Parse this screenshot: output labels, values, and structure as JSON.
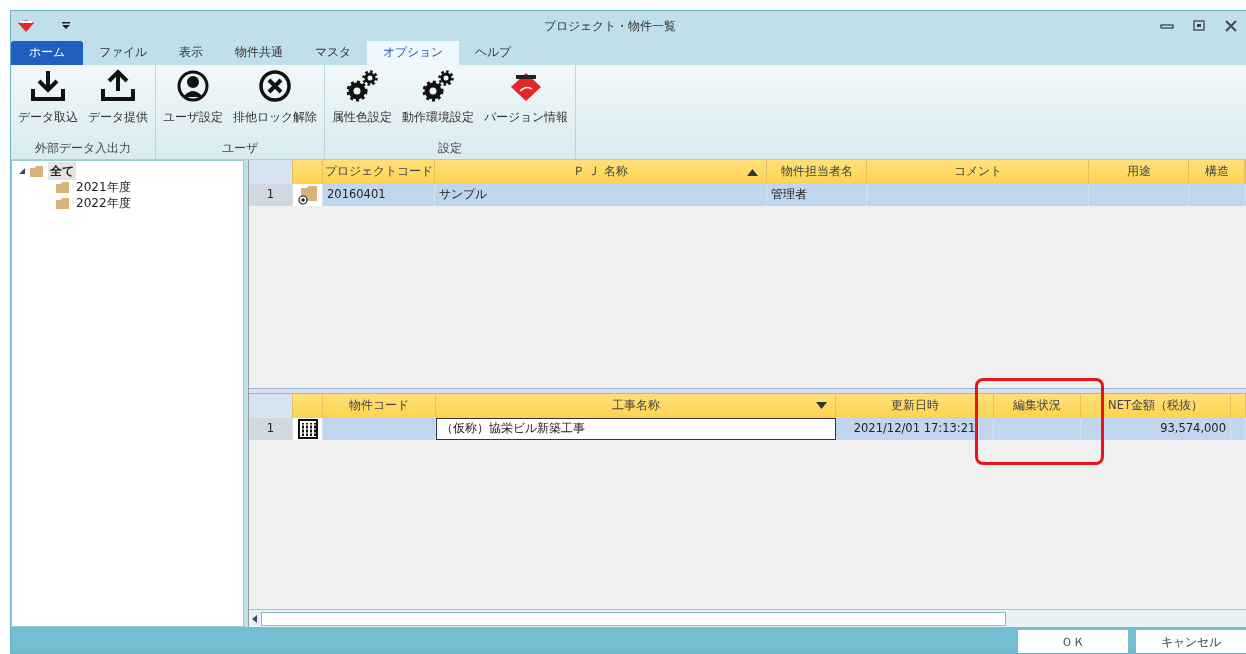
{
  "window": {
    "title": "プロジェクト・物件一覧"
  },
  "tabs": [
    {
      "label": "ホーム",
      "kind": "home",
      "selected": false
    },
    {
      "label": "ファイル",
      "kind": "tab",
      "selected": false
    },
    {
      "label": "表示",
      "kind": "tab",
      "selected": false
    },
    {
      "label": "物件共通",
      "kind": "tab",
      "selected": false
    },
    {
      "label": "マスタ",
      "kind": "tab",
      "selected": false
    },
    {
      "label": "オプション",
      "kind": "tab",
      "selected": true
    },
    {
      "label": "ヘルプ",
      "kind": "tab",
      "selected": false
    }
  ],
  "ribbon_groups": [
    {
      "label": "外部データ入出力",
      "buttons": [
        {
          "label": "データ取込"
        },
        {
          "label": "データ提供"
        }
      ]
    },
    {
      "label": "ユーザ",
      "buttons": [
        {
          "label": "ユーザ設定"
        },
        {
          "label": "排他ロック解除"
        }
      ]
    },
    {
      "label": "設定",
      "buttons": [
        {
          "label": "属性色設定"
        },
        {
          "label": "動作環境設定"
        },
        {
          "label": "バージョン情報"
        }
      ]
    }
  ],
  "tree": {
    "label": "全て",
    "expanded": true,
    "selected": true,
    "children": [
      {
        "label": "2021年度",
        "selected": false
      },
      {
        "label": "2022年度",
        "selected": false
      }
    ]
  },
  "project_table": {
    "columns": [
      {
        "label": "プロジェクトコード",
        "sorted": false
      },
      {
        "label": "Ｐ Ｊ 名称",
        "sorted": true,
        "descending": false
      },
      {
        "label": "物件担当者名",
        "sorted": false
      },
      {
        "label": "コメント",
        "sorted": false
      },
      {
        "label": "用途",
        "sorted": false
      },
      {
        "label": "構造",
        "sorted": false
      }
    ],
    "rows": [
      {
        "number": "1",
        "selected": true,
        "cells": [
          {
            "text": "20160401",
            "focused": false
          },
          {
            "text": "サンプル",
            "focused": false
          },
          {
            "text": "管理者",
            "focused": false
          },
          {
            "focused": false
          },
          {
            "focused": false
          },
          {
            "focused": false
          }
        ]
      }
    ]
  },
  "property_table": {
    "columns": [
      {
        "label": "物件コード",
        "sorted": false
      },
      {
        "label": "工事名称",
        "sorted": true,
        "descending": true
      },
      {
        "label": "更新日時",
        "sorted": false
      },
      {
        "label": "編集状況",
        "sorted": false
      },
      {
        "label": "NET金額（税抜）",
        "sorted": false
      }
    ],
    "rows": [
      {
        "number": "1",
        "selected": true,
        "cells": [
          {
            "focused": false
          },
          {
            "text": "（仮称）協栄ビル新築工事",
            "focused": true
          },
          {
            "text": "2021/12/01 17:13:21",
            "focused": false
          },
          {
            "focused": false
          },
          {
            "text": "93,574,000",
            "focused": false
          }
        ]
      }
    ]
  },
  "buttons": [
    {
      "label": "ＯＫ"
    },
    {
      "label": "キャンセル"
    }
  ]
}
